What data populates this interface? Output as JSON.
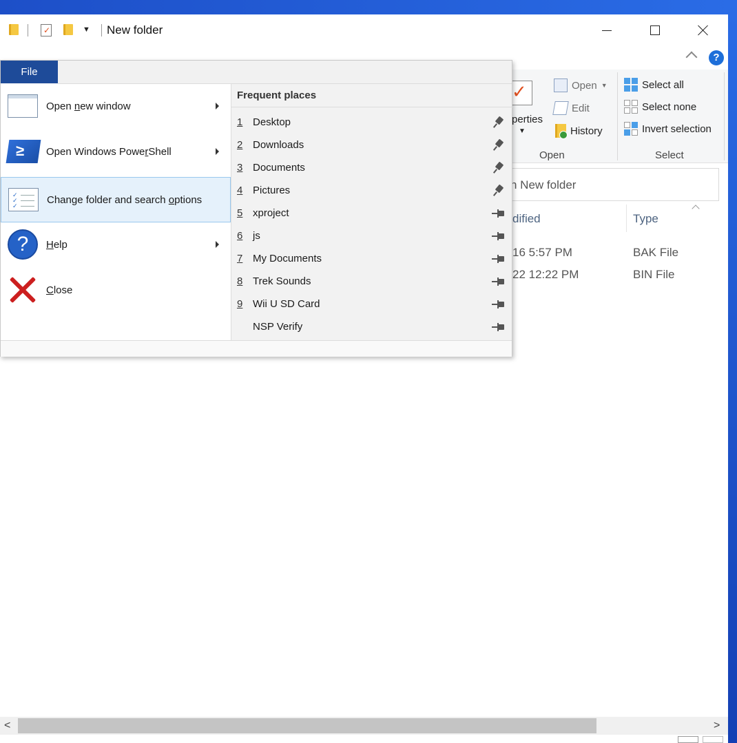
{
  "window": {
    "title": "New folder"
  },
  "ribbon": {
    "properties_label": "perties",
    "open_label": "Open",
    "edit_label": "Edit",
    "history_label": "History",
    "open_group_label": "Open",
    "select_all_label": "Select all",
    "select_none_label": "Select none",
    "invert_selection_label": "Invert selection",
    "select_group_label": "Select"
  },
  "search": {
    "text": "n New folder"
  },
  "file_list": {
    "headers": [
      "dified",
      "Type"
    ],
    "rows": [
      {
        "modified": "16 5:57 PM",
        "type": "BAK File"
      },
      {
        "modified": "22 12:22 PM",
        "type": "BIN File"
      }
    ]
  },
  "file_menu": {
    "tab_label": "File",
    "items": [
      {
        "pre": "Open ",
        "accel": "n",
        "post": "ew window",
        "submenu": true
      },
      {
        "pre": "Open Windows Powe",
        "accel": "r",
        "post": "Shell",
        "submenu": true
      },
      {
        "pre": "Change folder and search ",
        "accel": "o",
        "post": "ptions",
        "submenu": false
      },
      {
        "pre": "",
        "accel": "H",
        "post": "elp",
        "submenu": true
      },
      {
        "pre": "",
        "accel": "C",
        "post": "lose",
        "submenu": false
      }
    ],
    "frequent_places_title": "Frequent places",
    "frequent_places": [
      {
        "num": "1",
        "name": "Desktop",
        "pinned": true
      },
      {
        "num": "2",
        "name": "Downloads",
        "pinned": true
      },
      {
        "num": "3",
        "name": "Documents",
        "pinned": true
      },
      {
        "num": "4",
        "name": "Pictures",
        "pinned": true
      },
      {
        "num": "5",
        "name": "xproject",
        "pinned": false
      },
      {
        "num": "6",
        "name": "js",
        "pinned": false
      },
      {
        "num": "7",
        "name": "My Documents",
        "pinned": false
      },
      {
        "num": "8",
        "name": "Trek Sounds",
        "pinned": false
      },
      {
        "num": "9",
        "name": "Wii U SD Card",
        "pinned": false
      },
      {
        "num": "",
        "name": "NSP Verify",
        "pinned": false
      }
    ]
  },
  "colors": {
    "file_tab": "#1e4b99",
    "hover_bg": "#e5f1fb",
    "desktop": "#1c5fd6"
  }
}
